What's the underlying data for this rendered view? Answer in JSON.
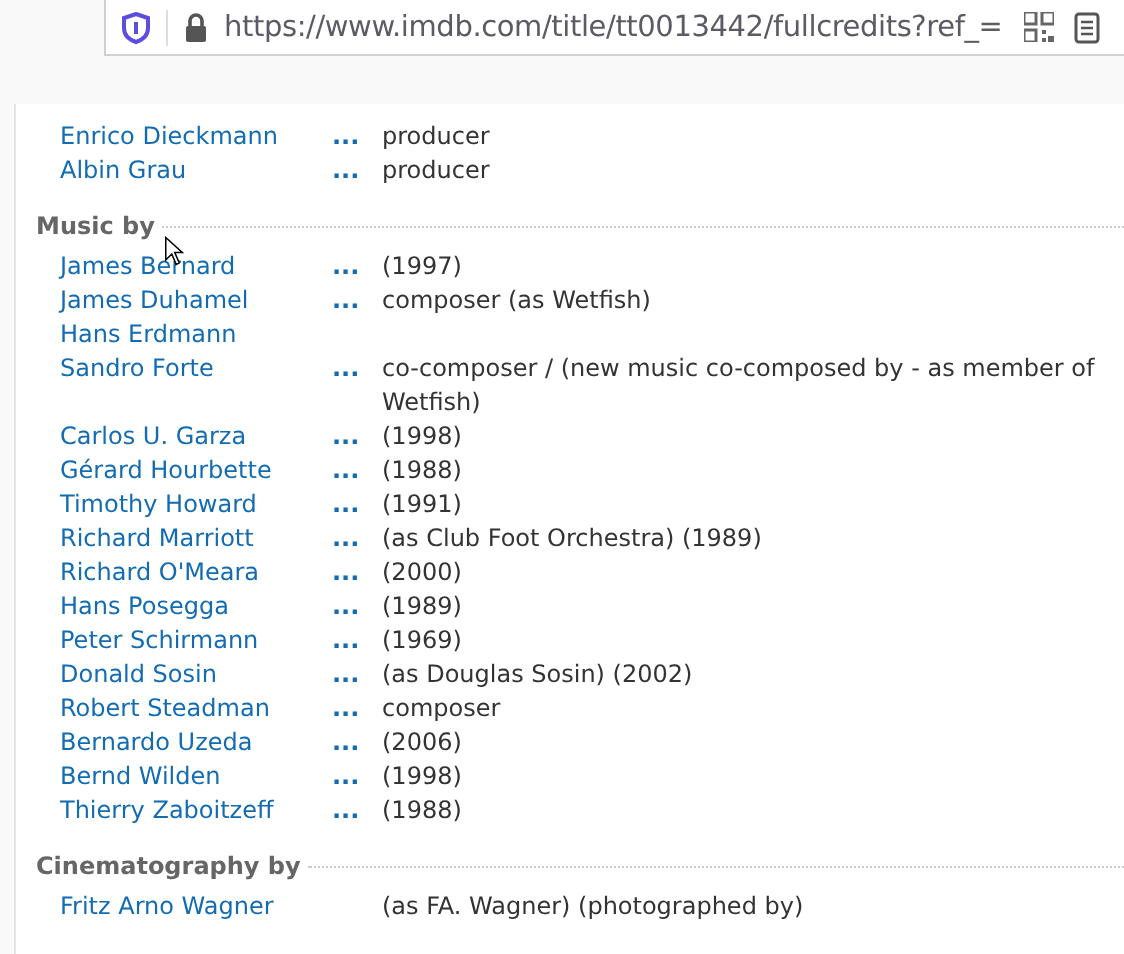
{
  "address_bar": {
    "url": "https://www.imdb.com/title/tt0013442/fullcredits?ref_="
  },
  "sections": [
    {
      "rows": [
        {
          "name": "Enrico Dieckmann",
          "dots": "...",
          "credit": "producer"
        },
        {
          "name": "Albin Grau",
          "dots": "...",
          "credit": "producer"
        }
      ]
    },
    {
      "heading": "Music by",
      "rows": [
        {
          "name": "James Bernard",
          "dots": "...",
          "credit": "(1997)"
        },
        {
          "name": "James Duhamel",
          "dots": "...",
          "credit": "composer (as Wetfish)"
        },
        {
          "name": "Hans Erdmann"
        },
        {
          "name": "Sandro Forte",
          "dots": "...",
          "credit": "co-composer / (new music co-composed by - as member of Wetfish)"
        },
        {
          "name": "Carlos U. Garza",
          "dots": "...",
          "credit": "(1998)"
        },
        {
          "name": "Gérard Hourbette",
          "dots": "...",
          "credit": "(1988)"
        },
        {
          "name": "Timothy Howard",
          "dots": "...",
          "credit": "(1991)"
        },
        {
          "name": "Richard Marriott",
          "dots": "...",
          "credit": "(as Club Foot Orchestra) (1989)"
        },
        {
          "name": "Richard O'Meara",
          "dots": "...",
          "credit": "(2000)"
        },
        {
          "name": "Hans Posegga",
          "dots": "...",
          "credit": "(1989)"
        },
        {
          "name": "Peter Schirmann",
          "dots": "...",
          "credit": "(1969)"
        },
        {
          "name": "Donald Sosin",
          "dots": "...",
          "credit": "(as Douglas Sosin) (2002)"
        },
        {
          "name": "Robert Steadman",
          "dots": "...",
          "credit": "composer"
        },
        {
          "name": "Bernardo Uzeda",
          "dots": "...",
          "credit": "(2006)"
        },
        {
          "name": "Bernd Wilden",
          "dots": "...",
          "credit": "(1998)"
        },
        {
          "name": "Thierry Zaboitzeff",
          "dots": "...",
          "credit": "(1988)"
        }
      ]
    },
    {
      "heading": "Cinematography by",
      "rows": [
        {
          "name": "Fritz Arno Wagner",
          "credit": "(as FA. Wagner) (photographed by)"
        }
      ]
    }
  ]
}
